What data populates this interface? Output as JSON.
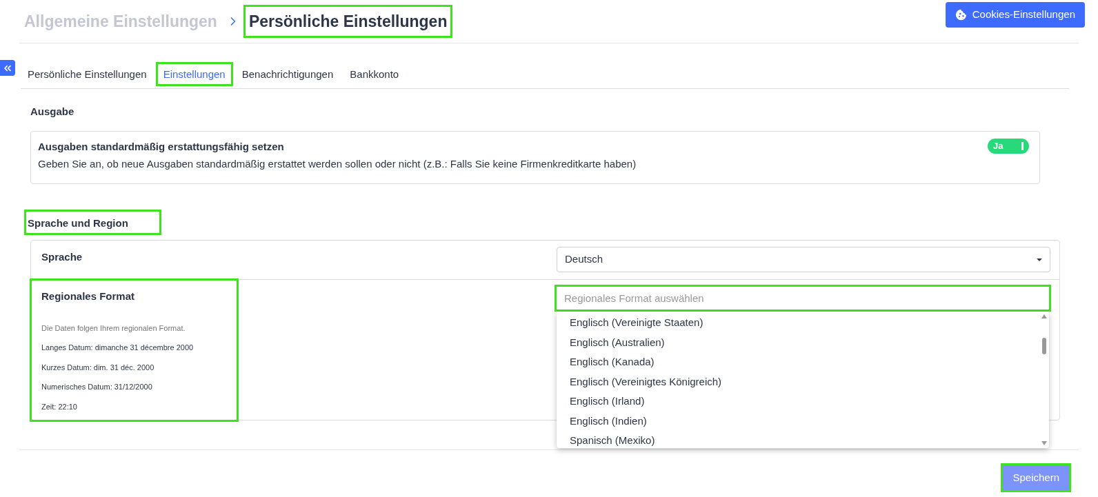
{
  "breadcrumb": [
    {
      "label": "Allgemeine Einstellungen",
      "current": false,
      "highlighted": false
    },
    {
      "label": "Persönliche Einstellungen",
      "current": true,
      "highlighted": true
    }
  ],
  "cookies_button": {
    "label": "Cookies-Einstellungen"
  },
  "tabs": [
    {
      "label": "Persönliche Einstellungen",
      "selected": false,
      "highlighted": false
    },
    {
      "label": "Einstellungen",
      "selected": true,
      "highlighted": true
    },
    {
      "label": "Benachrichtigungen",
      "selected": false,
      "highlighted": false
    },
    {
      "label": "Bankkonto",
      "selected": false,
      "highlighted": false
    }
  ],
  "expense_section": {
    "title": "Ausgabe",
    "highlighted": false,
    "setting": {
      "title": "Ausgaben standardmäßig erstattungsfähig setzen",
      "description": "Geben Sie an, ob neue Ausgaben standardmäßig erstattet werden sollen oder nicht (z.B.: Falls Sie keine Firmenkreditkarte haben)",
      "toggle": {
        "label": "Ja",
        "on": true
      }
    }
  },
  "language_section": {
    "title": "Sprache und Region",
    "highlighted": true,
    "language": {
      "label": "Sprache",
      "value": "Deutsch"
    },
    "regional_format": {
      "label": "Regionales Format",
      "highlighted": true,
      "hint": "Die Daten folgen Ihrem regionalen Format.",
      "lines": [
        "Langes Datum: dimanche 31 décembre 2000",
        "Kurzes Datum: dim. 31 déc. 2000",
        "Numerisches Datum: 31/12/2000",
        "Zeit: 22:10"
      ],
      "field": {
        "placeholder": "Regionales Format auswählen",
        "highlighted": true
      },
      "options": [
        "Englisch (Vereinigte Staaten)",
        "Englisch (Australien)",
        "Englisch (Kanada)",
        "Englisch (Vereinigtes Königreich)",
        "Englisch (Irland)",
        "Englisch (Indien)",
        "Spanisch (Mexiko)"
      ]
    }
  },
  "save_button": {
    "label": "Speichern",
    "disabled": true,
    "highlighted": true
  }
}
